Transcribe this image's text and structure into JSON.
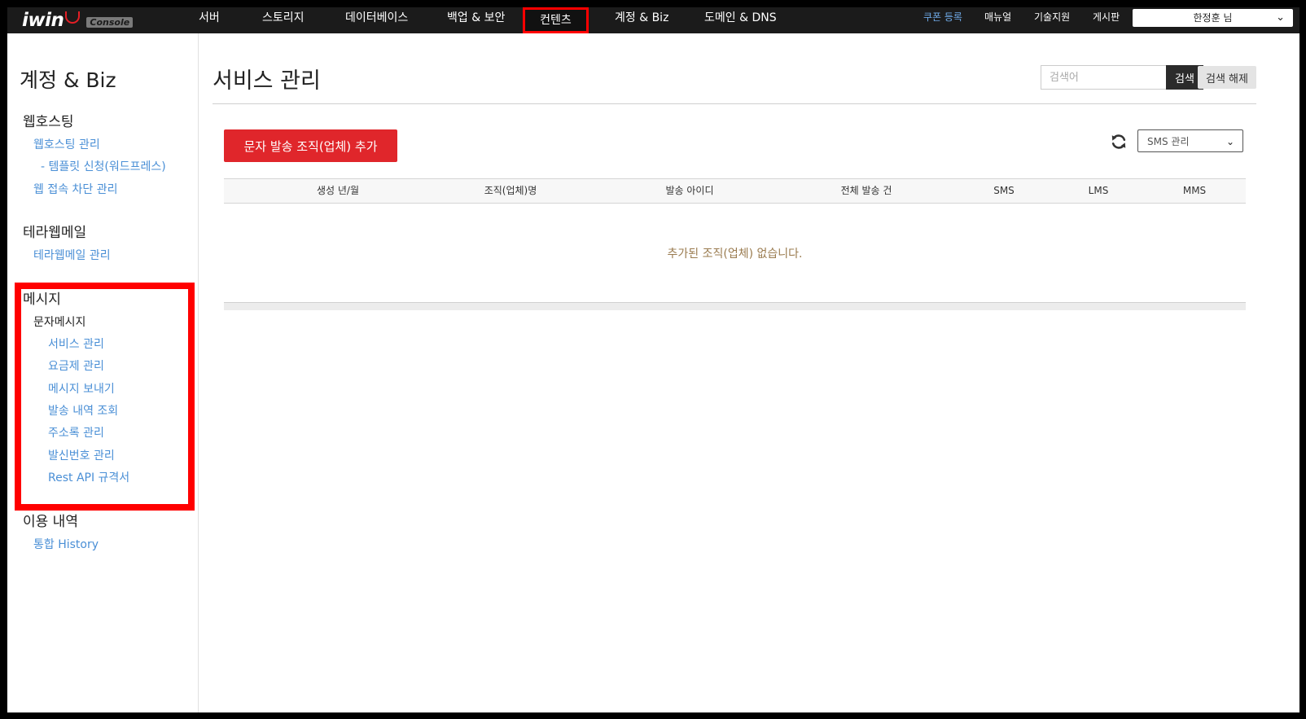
{
  "brand": {
    "logo": "iwin",
    "console": "Console"
  },
  "topnav": {
    "items": [
      "서버",
      "스토리지",
      "데이터베이스",
      "백업 & 보안",
      "컨텐츠",
      "계정 & Biz",
      "도메인 & DNS"
    ],
    "utility": [
      "쿠폰 등록",
      "매뉴얼",
      "기술지원",
      "게시판"
    ],
    "user": "한정훈 님"
  },
  "sidebar": {
    "title": "계정 & Biz",
    "sections": [
      {
        "heading": "웹호스팅",
        "links": [
          "웹호스팅 관리",
          "- 템플릿 신청(워드프레스)",
          "웹 접속 차단 관리"
        ]
      },
      {
        "heading": "테라웹메일",
        "links": [
          "테라웹메일 관리"
        ]
      },
      {
        "heading": "메시지",
        "sub": "문자메시지",
        "links": [
          "서비스 관리",
          "요금제 관리",
          "메시지 보내기",
          "발송 내역 조회",
          "주소록 관리",
          "발신번호 관리",
          "Rest API 규격서"
        ]
      },
      {
        "heading": "이용 내역",
        "links": [
          "통합 History"
        ]
      }
    ]
  },
  "main": {
    "title": "서비스 관리",
    "search": {
      "placeholder": "검색어",
      "button": "검색",
      "clear": "검색 해제"
    },
    "add_button": "문자 발송 조직(업체) 추가",
    "filter": "SMS 관리",
    "table": {
      "columns": [
        "생성 년/월",
        "조직(업체)명",
        "발송 아이디",
        "전체 발송 건",
        "SMS",
        "LMS",
        "MMS"
      ],
      "empty": "추가된 조직(업체) 없습니다."
    }
  },
  "colors": {
    "accent_red": "#e0262b",
    "highlight": "#ff0000",
    "link_blue": "#4a8fd6",
    "topbar": "#1b1b1b"
  },
  "icons": [
    "refresh-icon",
    "chevron-down-icon"
  ]
}
